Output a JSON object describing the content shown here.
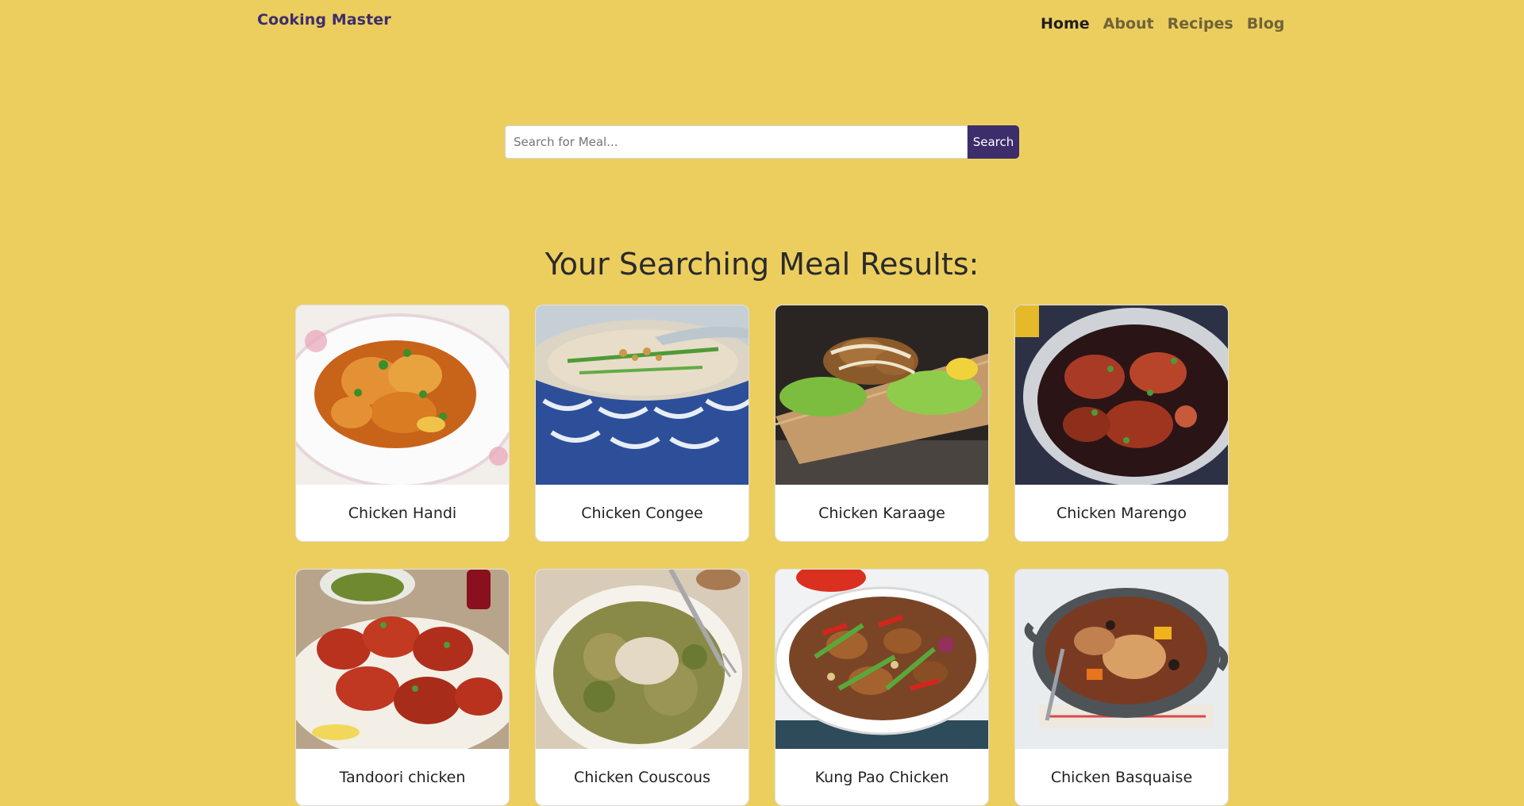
{
  "header": {
    "brand": "Cooking Master",
    "nav": [
      {
        "label": "Home",
        "active": true
      },
      {
        "label": "About",
        "active": false
      },
      {
        "label": "Recipes",
        "active": false
      },
      {
        "label": "Blog",
        "active": false
      }
    ]
  },
  "search": {
    "placeholder": "Search for Meal...",
    "value": "",
    "button_label": "Search"
  },
  "results": {
    "title": "Your Searching Meal Results:",
    "meals": [
      {
        "name": "Chicken Handi",
        "image": "plated curry chicken"
      },
      {
        "name": "Chicken Congee",
        "image": "congee bowl"
      },
      {
        "name": "Chicken Karaage",
        "image": "karaage on board"
      },
      {
        "name": "Chicken Marengo",
        "image": "marengo pan"
      },
      {
        "name": "Tandoori chicken",
        "image": "tandoori platter"
      },
      {
        "name": "Chicken Couscous",
        "image": "couscous plate"
      },
      {
        "name": "Kung Pao Chicken",
        "image": "kung pao bowl"
      },
      {
        "name": "Chicken Basquaise",
        "image": "basquaise pan"
      }
    ]
  },
  "colors": {
    "background": "#ecce5f",
    "brand": "#3d2d6b",
    "search_button": "#3d2d6b",
    "card": "#ffffff"
  }
}
